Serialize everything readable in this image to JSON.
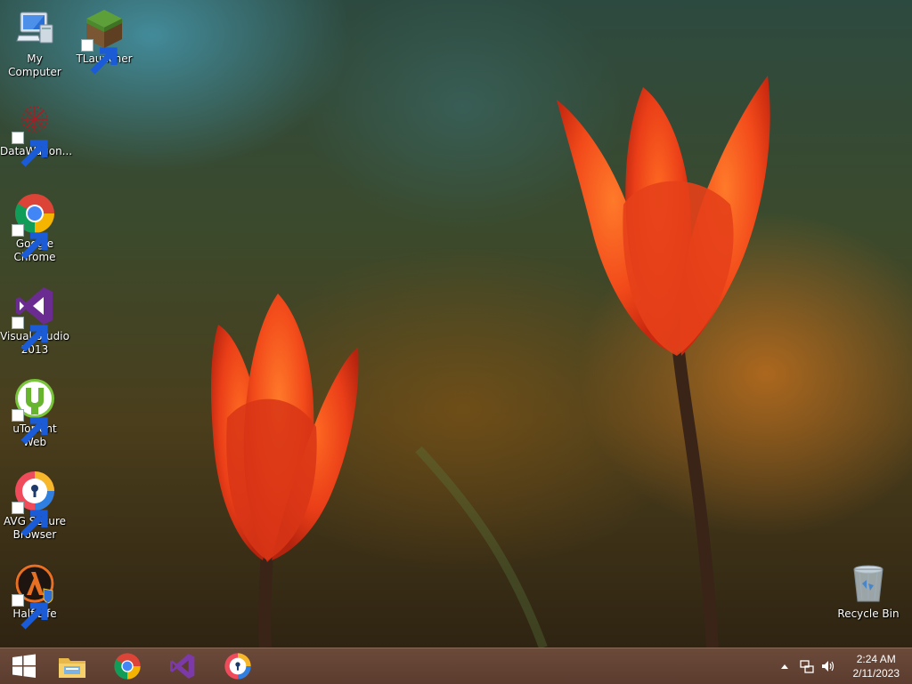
{
  "desktop": {
    "icons": [
      {
        "label": "My Computer",
        "icon": "computer-icon"
      },
      {
        "label": "TLauncher",
        "icon": "minecraft-block-icon"
      },
      {
        "label": "DataWagon...",
        "icon": "datawagon-icon"
      },
      {
        "label": "Google\nChrome",
        "icon": "chrome-icon"
      },
      {
        "label": "Visual Studio\n2013",
        "icon": "visual-studio-icon"
      },
      {
        "label": "uTorrent Web",
        "icon": "utorrent-icon"
      },
      {
        "label": "AVG Secure\nBrowser",
        "icon": "avg-browser-icon"
      },
      {
        "label": "Half-Life",
        "icon": "half-life-icon"
      },
      {
        "label": "Recycle Bin",
        "icon": "recycle-bin-icon"
      }
    ]
  },
  "taskbar": {
    "pinned": [
      "windows-start-icon",
      "file-explorer-icon",
      "chrome-icon",
      "visual-studio-icon",
      "avg-browser-icon"
    ],
    "tray": [
      "chevron-up-icon",
      "network-icon",
      "volume-icon"
    ],
    "clock": {
      "time": "2:24 AM",
      "date": "2/11/2023"
    }
  }
}
